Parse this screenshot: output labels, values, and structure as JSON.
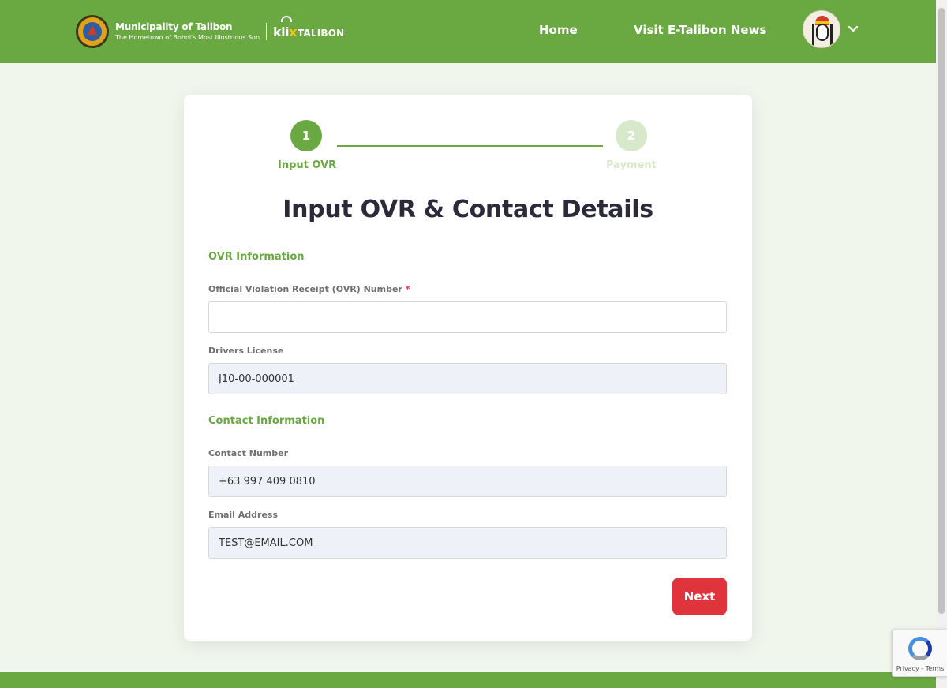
{
  "header": {
    "brand_title": "Municipality of Talibon",
    "brand_subtitle": "The Hometown of Bohol's Most Illustrious Son",
    "klik_k": "kli",
    "klik_x": "x",
    "klik_talibon": "TALIBON",
    "nav": [
      "Home",
      "Visit E-Talibon News"
    ]
  },
  "stepper": {
    "steps": [
      {
        "number": "1",
        "label": "Input OVR",
        "active": true
      },
      {
        "number": "2",
        "label": "Payment",
        "active": false
      }
    ]
  },
  "form": {
    "heading": "Input OVR & Contact Details",
    "ovr_section": "OVR Information",
    "ovr_label": "Official Violation Receipt (OVR) Number",
    "required_mark": "*",
    "ovr_value": "",
    "license_label": "Drivers License",
    "license_value": "J10-00-000001",
    "contact_section": "Contact Information",
    "contact_label": "Contact Number",
    "contact_value": "+63 997 409 0810",
    "email_label": "Email Address",
    "email_value": "TEST@EMAIL.COM",
    "next_label": "Next"
  },
  "recaptcha": {
    "links": "Privacy - Terms"
  },
  "colors": {
    "brand_green": "#6aa842",
    "button_red": "#e0343d",
    "heading": "#2b2a3a"
  },
  "icons": [
    "municipal-seal-icon",
    "wifi-icon",
    "avatar-icon",
    "chevron-down-icon",
    "recaptcha-icon"
  ]
}
